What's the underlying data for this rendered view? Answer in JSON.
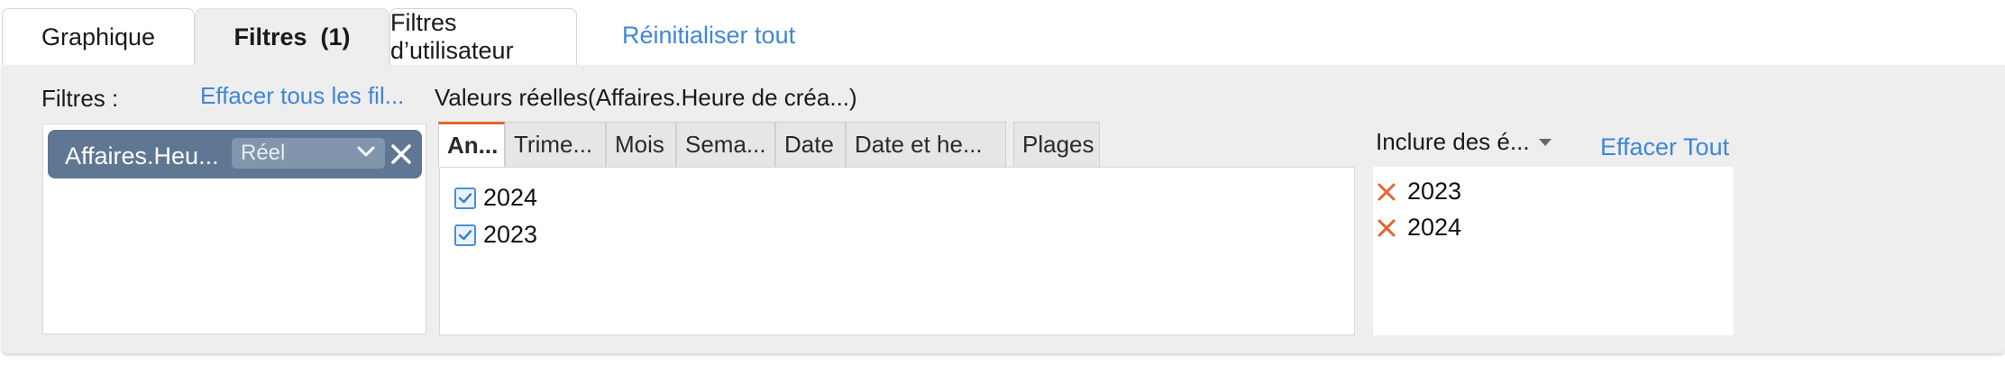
{
  "tabs": {
    "graphique": "Graphique",
    "filtres": "Filtres  (1)",
    "user_filters": "Filtres d’utilisateur",
    "reset_all": "Réinitialiser tout"
  },
  "filters_panel": {
    "label": "Filtres :",
    "clear_all": "Effacer tous les fil...",
    "active_filter": {
      "name": "Affaires.Heu...",
      "mode": "Réel"
    }
  },
  "values_panel": {
    "title": "Valeurs réelles(Affaires.Heure de créa...)",
    "subtabs": [
      "An...",
      "Trime...",
      "Mois",
      "Sema...",
      "Date",
      "Date et he...",
      "Plages"
    ],
    "active_subtab": 0,
    "values": [
      {
        "label": "2024",
        "checked": true
      },
      {
        "label": "2023",
        "checked": true
      }
    ]
  },
  "selection_panel": {
    "mode": "Inclure des é...",
    "clear": "Effacer Tout",
    "items": [
      "2023",
      "2024"
    ]
  },
  "colors": {
    "accent_link": "#3f86d9",
    "chip_bg": "#5f7793",
    "active_tab_marker": "#e0662f",
    "remove_icon": "#e0662f"
  }
}
